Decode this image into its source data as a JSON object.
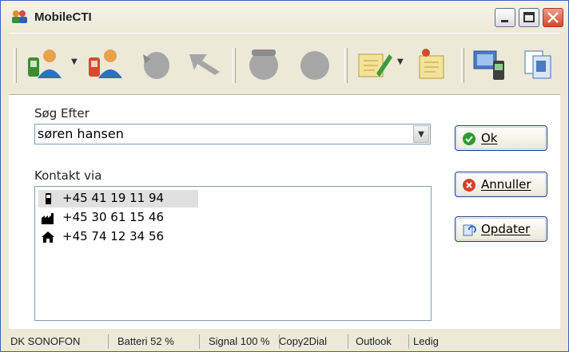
{
  "window": {
    "title": "MobileCTI"
  },
  "search": {
    "label": "Søg Efter",
    "value": "søren hansen"
  },
  "contacts": {
    "label": "Kontakt via",
    "items": [
      {
        "number": "+45 41 19 11 94",
        "type": "mobile-icon"
      },
      {
        "number": "+45 30 61 15 46",
        "type": "factory-icon"
      },
      {
        "number": "+45 74 12 34 56",
        "type": "house-icon"
      }
    ]
  },
  "buttons": {
    "ok": "Ok",
    "cancel": "Annuller",
    "refresh": "Opdater"
  },
  "status": {
    "operator": "DK SONOFON",
    "battery": "Batteri 52 %",
    "signal": "Signal 100 %",
    "copy2dial": "Copy2Dial",
    "outlook": "Outlook",
    "state": "Ledig"
  },
  "colors": {
    "accent": "#3b62b5",
    "ok_icon": "#2e9a2e",
    "cancel_icon": "#d9402a"
  }
}
